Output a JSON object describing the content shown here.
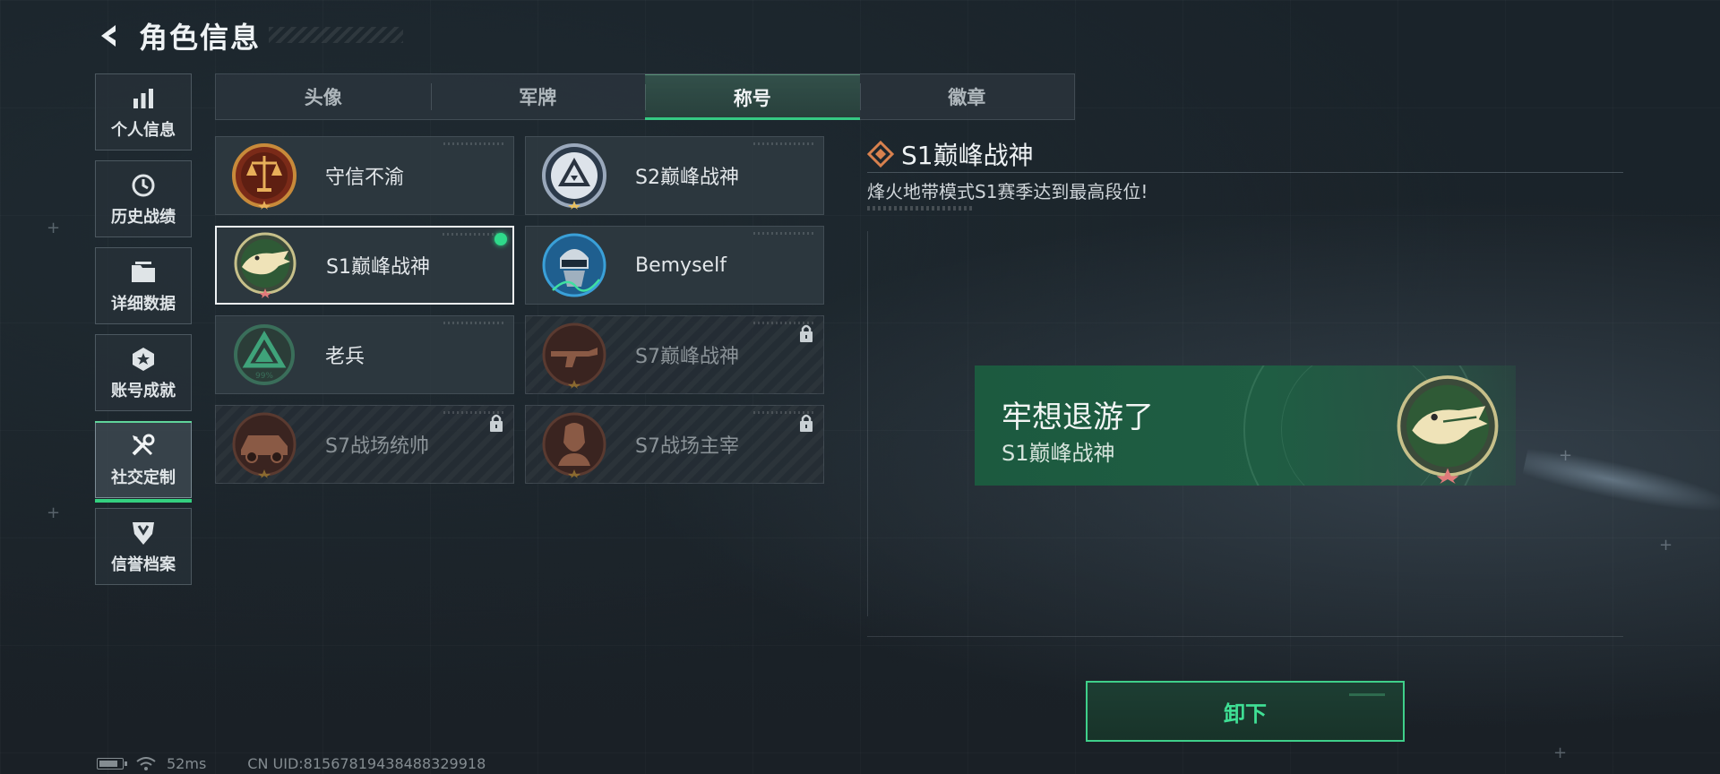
{
  "header": {
    "title": "角色信息"
  },
  "sidebar": {
    "items": [
      {
        "label": "个人信息",
        "icon": "bar-chart-icon",
        "active": false
      },
      {
        "label": "历史战绩",
        "icon": "clock-icon",
        "active": false
      },
      {
        "label": "详细数据",
        "icon": "folder-icon",
        "active": false
      },
      {
        "label": "账号成就",
        "icon": "badge-icon",
        "active": false
      },
      {
        "label": "社交定制",
        "icon": "tools-icon",
        "active": true
      },
      {
        "label": "信誉档案",
        "icon": "shield-icon",
        "active": false
      }
    ]
  },
  "tabs": [
    {
      "label": "头像",
      "active": false
    },
    {
      "label": "军牌",
      "active": false
    },
    {
      "label": "称号",
      "active": true
    },
    {
      "label": "徽章",
      "active": false
    }
  ],
  "cards": [
    {
      "label": "守信不渝",
      "emblem": "scales-emblem",
      "locked": false,
      "selected": false,
      "equipped": false
    },
    {
      "label": "S2巅峰战神",
      "emblem": "triangle-emblem",
      "locked": false,
      "selected": false,
      "equipped": false
    },
    {
      "label": "S1巅峰战神",
      "emblem": "crocodile-emblem",
      "locked": false,
      "selected": true,
      "equipped": true
    },
    {
      "label": "Bemyself",
      "emblem": "soldier-emblem",
      "locked": false,
      "selected": false,
      "equipped": false
    },
    {
      "label": "老兵",
      "emblem": "veteran-emblem",
      "locked": false,
      "selected": false,
      "equipped": false,
      "emblem_text": "99%"
    },
    {
      "label": "S7巅峰战神",
      "emblem": "rifle-emblem",
      "locked": true,
      "selected": false,
      "equipped": false
    },
    {
      "label": "S7战场统帅",
      "emblem": "vehicle-emblem",
      "locked": true,
      "selected": false,
      "equipped": false
    },
    {
      "label": "S7战场主宰",
      "emblem": "operator-emblem",
      "locked": true,
      "selected": false,
      "equipped": false
    }
  ],
  "detail": {
    "title": "S1巅峰战神",
    "description": "烽火地带模式S1赛季达到最高段位!"
  },
  "preview": {
    "player_name": "牢想退游了",
    "title": "S1巅峰战神"
  },
  "actions": {
    "unequip_label": "卸下"
  },
  "status_bar": {
    "ping": "52ms",
    "uid": "CN UID:8156781943848832991​8",
    "battery_level": 0.85
  },
  "colors": {
    "accent": "#35c983",
    "equipped_dot": "#2fd98a",
    "banner": "#1c5a3f"
  }
}
